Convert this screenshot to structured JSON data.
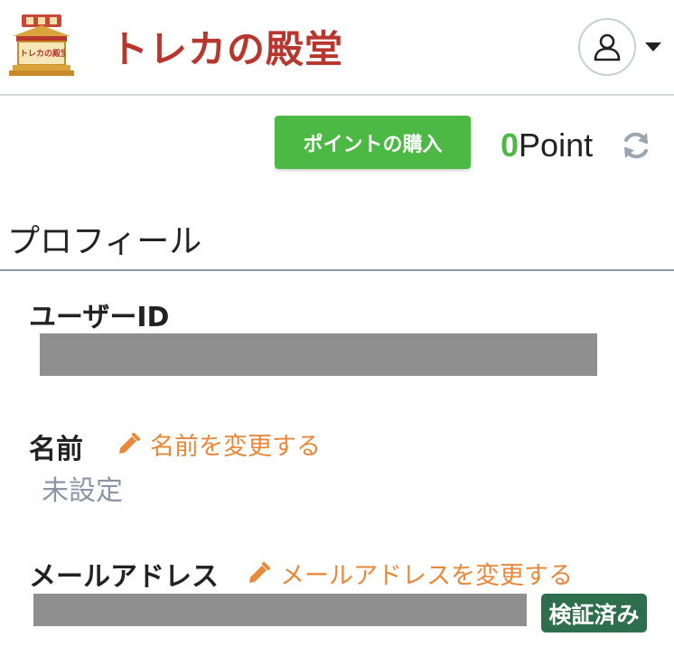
{
  "header": {
    "logo_badge_text": "トレカの殿堂",
    "site_title": "トレカの殿堂",
    "user_menu_icon": "user-avatar-icon",
    "caret_icon": "caret-down-icon"
  },
  "points": {
    "buy_label": "ポイントの購入",
    "amount": "0",
    "unit": "Point",
    "refresh_icon": "refresh-icon"
  },
  "profile": {
    "title": "プロフィール",
    "user_id_label": "ユーザーID",
    "name_label": "名前",
    "name_edit_label": "名前を変更する",
    "name_value": "未設定",
    "email_label": "メールアドレス",
    "email_edit_label": "メールアドレスを変更する",
    "email_verified_badge": "検証済み"
  },
  "colors": {
    "brand_red": "#b7362d",
    "accent_green": "#4cb944",
    "edit_orange": "#e8883a",
    "verified_green": "#2d6e4c",
    "muted_text": "#8a96a5",
    "redaction_gray": "#8f8f8f"
  }
}
